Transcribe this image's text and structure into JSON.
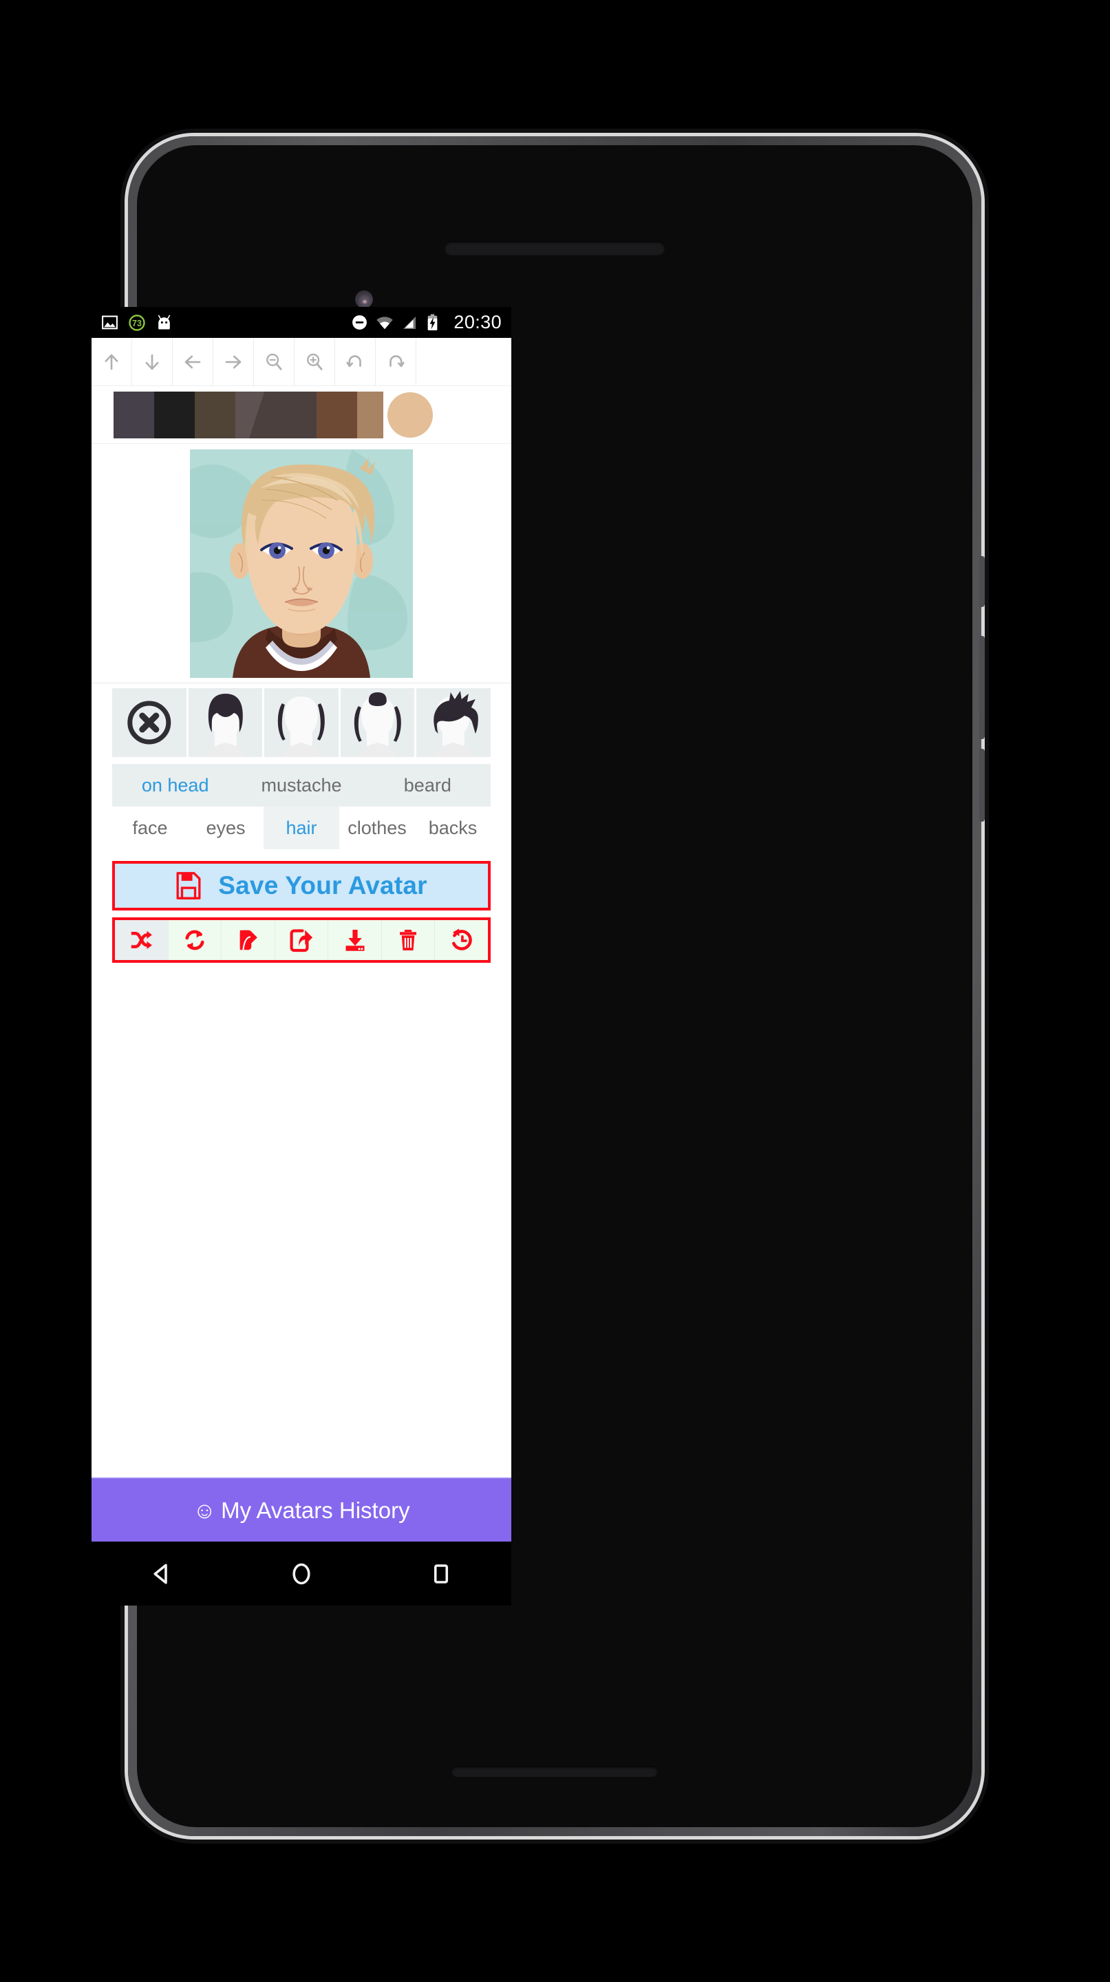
{
  "status_bar": {
    "clock": "20:30",
    "icons": [
      "image-icon",
      "battery-saver-73-icon",
      "android-head-icon",
      "do-not-disturb-icon",
      "wifi-icon",
      "cellular-signal-icon",
      "battery-charging-icon"
    ],
    "battery_saver_value": "73",
    "background": "#000000",
    "foreground": "#ffffff"
  },
  "toolbar": {
    "buttons": [
      {
        "name": "move-up-button",
        "icon": "arrow-up-icon"
      },
      {
        "name": "move-down-button",
        "icon": "arrow-down-icon"
      },
      {
        "name": "move-left-button",
        "icon": "arrow-left-icon"
      },
      {
        "name": "move-right-button",
        "icon": "arrow-right-icon"
      },
      {
        "name": "zoom-out-button",
        "icon": "magnifier-minus-icon"
      },
      {
        "name": "zoom-in-button",
        "icon": "magnifier-plus-icon"
      },
      {
        "name": "undo-button",
        "icon": "undo-icon"
      },
      {
        "name": "redo-button",
        "icon": "redo-icon"
      }
    ],
    "icon_color": "#b0b0b0"
  },
  "color_palette": {
    "swatches": [
      {
        "name": "color-swatch-1",
        "hex": "#45404a",
        "shape": "square",
        "selected": false
      },
      {
        "name": "color-swatch-2",
        "hex": "#1e1e1e",
        "shape": "square",
        "selected": false
      },
      {
        "name": "color-swatch-3",
        "hex": "#4f4436",
        "shape": "square",
        "selected": false
      },
      {
        "name": "color-swatch-4",
        "hex": "#594e4d",
        "shape": "square",
        "selected": false
      },
      {
        "name": "color-swatch-5",
        "hex": "#4b403d",
        "shape": "square",
        "selected": false
      },
      {
        "name": "color-swatch-6",
        "hex": "#6e4a35",
        "shape": "square",
        "selected": false
      },
      {
        "name": "color-swatch-7",
        "hex": "#a88464",
        "shape": "square",
        "selected": false
      },
      {
        "name": "color-swatch-8",
        "hex": "#e3be96",
        "shape": "circle",
        "selected": true
      }
    ]
  },
  "avatar": {
    "background_color": "#b5dcd6",
    "hair_color": "#dfbe8e",
    "skin_color": "#f0cdaa",
    "eye_color": "#5a63b0",
    "jacket_color": "#5d2f22",
    "shirt_color": "#ffffff"
  },
  "hair_thumbnails": [
    {
      "name": "hair-option-none",
      "icon": "x-circle-icon",
      "selected": false
    },
    {
      "name": "hair-option-bowl",
      "icon": "hair-bowl-icon",
      "selected": false
    },
    {
      "name": "hair-option-bald",
      "icon": "hair-bald-icon",
      "selected": false
    },
    {
      "name": "hair-option-tuft",
      "icon": "hair-tuft-icon",
      "selected": false
    },
    {
      "name": "hair-option-spiky",
      "icon": "hair-spiky-icon",
      "selected": false
    }
  ],
  "sub_tabs": {
    "items": [
      {
        "label": "on head",
        "active": true
      },
      {
        "label": "mustache",
        "active": false
      },
      {
        "label": "beard",
        "active": false
      }
    ],
    "active_color": "#2b9ae0",
    "inactive_color": "#6d6d6d"
  },
  "main_tabs": {
    "items": [
      {
        "label": "face",
        "active": false
      },
      {
        "label": "eyes",
        "active": false
      },
      {
        "label": "hair",
        "active": true
      },
      {
        "label": "clothes",
        "active": false
      },
      {
        "label": "backs",
        "active": false
      }
    ],
    "active_color": "#2b9ae0",
    "inactive_color": "#6d6d6d"
  },
  "save_button": {
    "label": "Save Your Avatar",
    "icon": "floppy-disk-save-icon",
    "text_color": "#2b9ae0",
    "border_color": "#fc0d1b",
    "background_color": "#cfe8fa"
  },
  "action_row": {
    "border_color": "#fc0d1b",
    "icon_color": "#fc0d1b",
    "buttons": [
      {
        "name": "randomize-button",
        "icon": "shuffle-icon"
      },
      {
        "name": "reset-button",
        "icon": "refresh-cycle-icon"
      },
      {
        "name": "share-button",
        "icon": "share-filled-icon"
      },
      {
        "name": "share-external-button",
        "icon": "share-outline-icon"
      },
      {
        "name": "download-button",
        "icon": "download-tray-icon"
      },
      {
        "name": "delete-button",
        "icon": "trash-icon"
      },
      {
        "name": "restore-button",
        "icon": "history-restore-icon"
      }
    ]
  },
  "history_bar": {
    "label": "My Avatars History",
    "emoji": "☺",
    "background_color": "#8568ee",
    "text_color": "#ffffff"
  },
  "nav_bar": {
    "buttons": [
      {
        "name": "android-back-button",
        "icon": "triangle-back-icon"
      },
      {
        "name": "android-home-button",
        "icon": "circle-home-icon"
      },
      {
        "name": "android-recents-button",
        "icon": "square-recents-icon"
      }
    ],
    "background_color": "#000000",
    "icon_color": "#f2f2f2"
  }
}
